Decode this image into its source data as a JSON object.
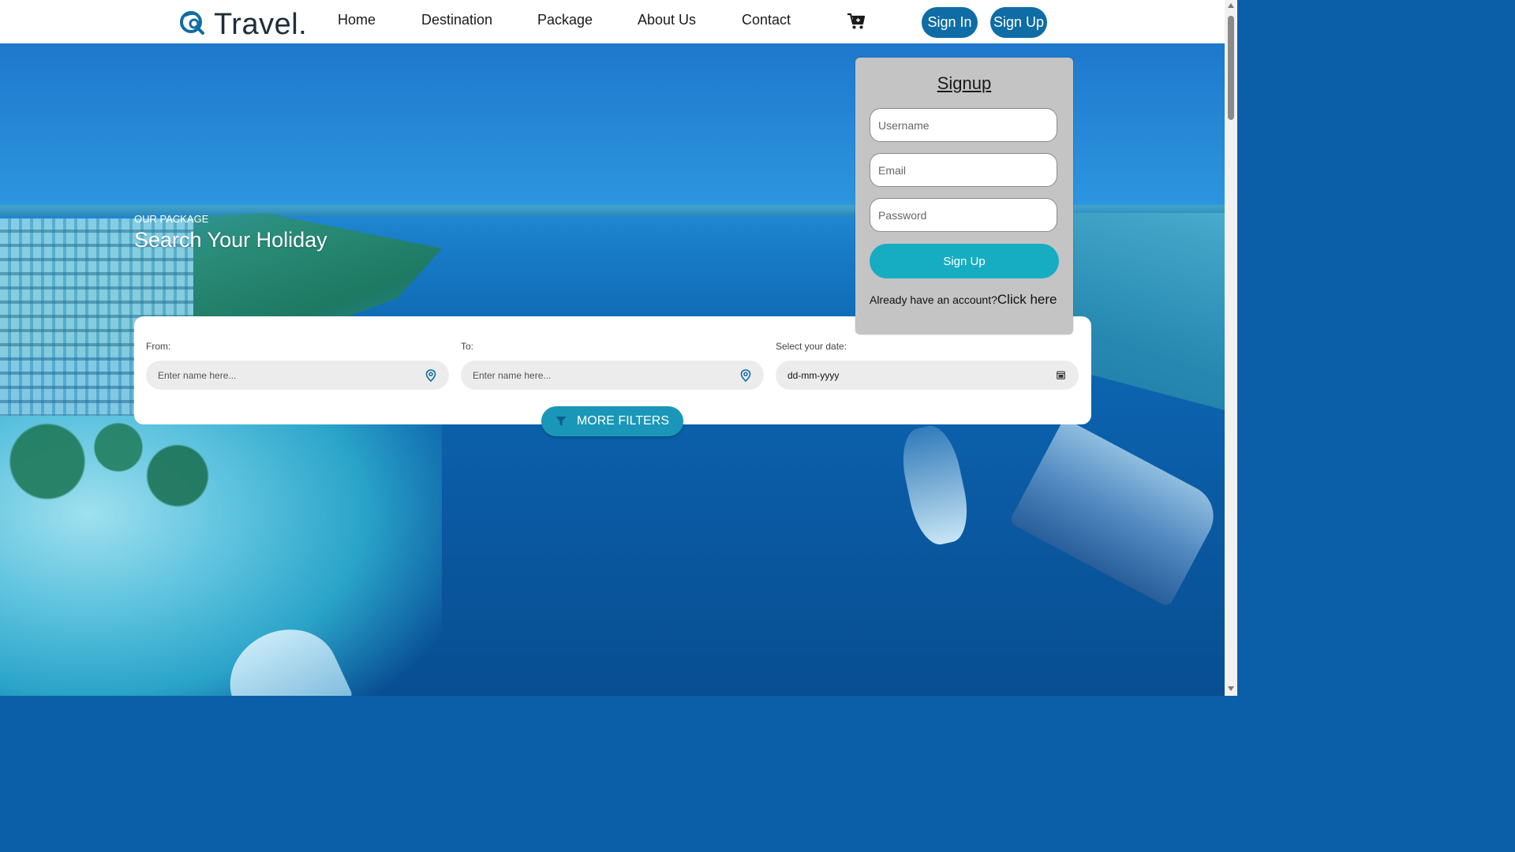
{
  "header": {
    "logo_text": "Travel.",
    "nav": [
      "Home",
      "Destination",
      "Package",
      "About Us",
      "Contact"
    ],
    "sign_in_label": "Sign In",
    "sign_up_label": "Sign Up",
    "cart_icon": "cart-icon",
    "brand_color": "#0f6ca5"
  },
  "hero": {
    "kicker": "OUR PACKAGE",
    "title": "Search Your Holiday"
  },
  "search": {
    "from_label": "From:",
    "from_placeholder": "Enter name here...",
    "to_label": "To:",
    "to_placeholder": "Enter name here...",
    "date_label": "Select your date:",
    "date_value": "dd-mm-yyyy",
    "more_filters_label": "MORE FILTERS"
  },
  "signup": {
    "title": "Signup",
    "username_placeholder": "Username",
    "email_placeholder": "Email",
    "password_placeholder": "Password",
    "submit_label": "Sign Up",
    "already_text": "Already have an account?",
    "click_here": "Click here",
    "accent_color": "#16adc2"
  }
}
